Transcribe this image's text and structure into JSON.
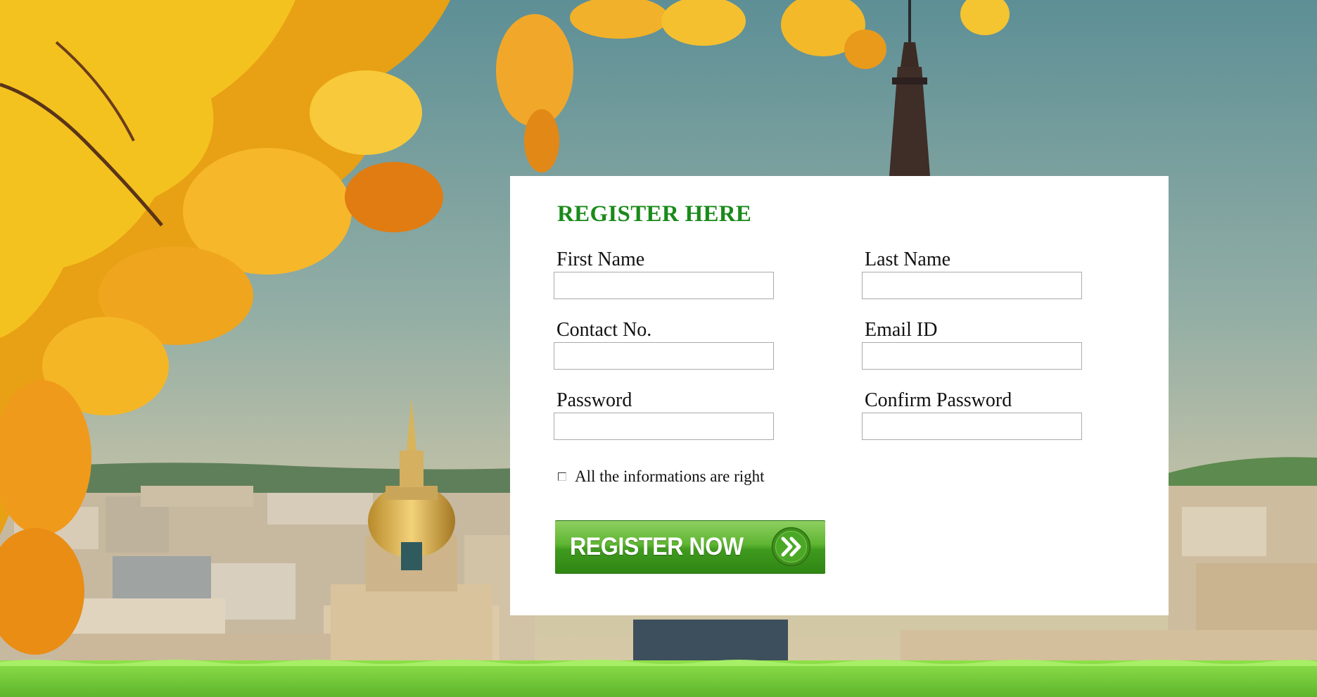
{
  "form": {
    "title": "REGISTER HERE",
    "fields": {
      "first_name": {
        "label": "First Name",
        "value": "",
        "placeholder": ""
      },
      "last_name": {
        "label": "Last Name",
        "value": "",
        "placeholder": ""
      },
      "contact": {
        "label": "Contact No.",
        "value": "",
        "placeholder": ""
      },
      "email": {
        "label": "Email ID",
        "value": "",
        "placeholder": ""
      },
      "password": {
        "label": "Password",
        "value": "",
        "placeholder": ""
      },
      "confirm_password": {
        "label": "Confirm Password",
        "value": "",
        "placeholder": ""
      }
    },
    "agree": {
      "label": "All the informations are right",
      "checked": false
    },
    "submit": {
      "label": "REGISTER NOW",
      "icon": "double-chevron-right-icon"
    }
  },
  "colors": {
    "title": "#1a8a1a",
    "button": "#4aa827",
    "panel": "#ffffff",
    "sky": "#8fb0a8",
    "grass": "#6cc93a",
    "leaves": "#f2a516"
  }
}
